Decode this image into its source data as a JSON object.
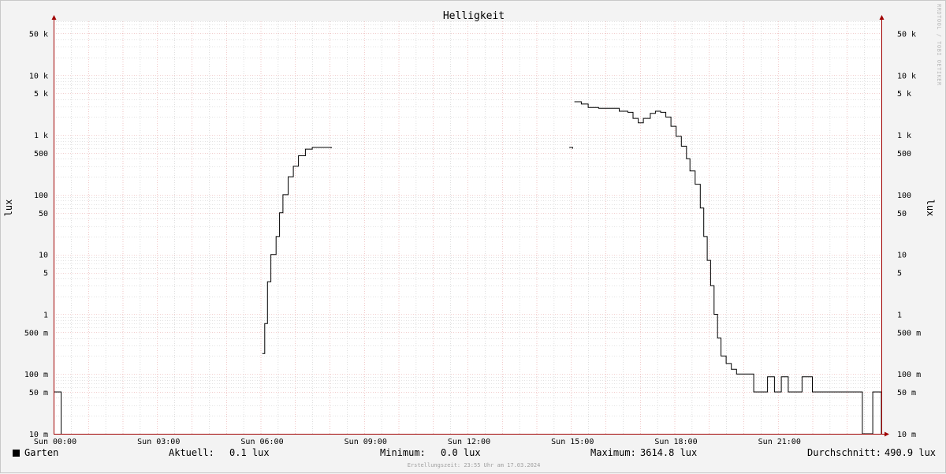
{
  "watermark": "RRDTOOL / TOBI OETIKER",
  "legend": {
    "series_name": "Garten",
    "current_label": "Aktuell:",
    "current_value": "0.1 lux",
    "min_label": "Minimum:",
    "min_value": "0.0 lux",
    "max_label": "Maximum:",
    "max_value": "3614.8 lux",
    "avg_label": "Durchschnitt:",
    "avg_value": "490.9 lux"
  },
  "footer_note": "Erstellungszeit: 23:55 Uhr am 17.03.2024",
  "colors": {
    "line": "#000000",
    "major_grid": "#e6a0a0",
    "minor_grid": "#c8c8c8",
    "plot_bg": "#ffffff",
    "axis": "#a00000"
  },
  "chart_data": {
    "type": "line",
    "title": "Helligkeit",
    "ylabel": "lux",
    "y_scale": "log",
    "ylim": [
      0.01,
      80000
    ],
    "xlim": [
      0,
      24
    ],
    "x_unit": "hours (Sun)",
    "x_ticks": [
      {
        "value": 0,
        "label": "Sun 00:00"
      },
      {
        "value": 3,
        "label": "Sun 03:00"
      },
      {
        "value": 6,
        "label": "Sun 06:00"
      },
      {
        "value": 9,
        "label": "Sun 09:00"
      },
      {
        "value": 12,
        "label": "Sun 12:00"
      },
      {
        "value": 15,
        "label": "Sun 15:00"
      },
      {
        "value": 18,
        "label": "Sun 18:00"
      },
      {
        "value": 21,
        "label": "Sun 21:00"
      }
    ],
    "y_ticks": [
      {
        "value": 0.01,
        "label": "10 m"
      },
      {
        "value": 0.05,
        "label": "50 m"
      },
      {
        "value": 0.1,
        "label": "100 m"
      },
      {
        "value": 0.5,
        "label": "500 m"
      },
      {
        "value": 1,
        "label": "1"
      },
      {
        "value": 5,
        "label": "5"
      },
      {
        "value": 10,
        "label": "10"
      },
      {
        "value": 50,
        "label": "50"
      },
      {
        "value": 100,
        "label": "100"
      },
      {
        "value": 500,
        "label": "500"
      },
      {
        "value": 1000,
        "label": "1 k"
      },
      {
        "value": 5000,
        "label": "5 k"
      },
      {
        "value": 10000,
        "label": "10 k"
      },
      {
        "value": 50000,
        "label": "50 k"
      }
    ],
    "series": [
      {
        "name": "Garten",
        "segments": [
          [
            [
              0.0,
              0.05
            ],
            [
              0.2,
              0.05
            ],
            [
              0.22,
              0.0
            ]
          ],
          [
            [
              6.05,
              0.22
            ],
            [
              6.12,
              0.7
            ],
            [
              6.2,
              3.5
            ],
            [
              6.3,
              10
            ],
            [
              6.45,
              20
            ],
            [
              6.55,
              50
            ],
            [
              6.65,
              100
            ],
            [
              6.8,
              200
            ],
            [
              6.95,
              300
            ],
            [
              7.1,
              450
            ],
            [
              7.3,
              580
            ],
            [
              7.5,
              620
            ],
            [
              7.8,
              620
            ],
            [
              8.05,
              600
            ]
          ],
          [
            [
              14.95,
              620
            ],
            [
              15.05,
              590
            ]
          ],
          [
            [
              15.1,
              3600
            ],
            [
              15.3,
              3300
            ],
            [
              15.5,
              2900
            ],
            [
              15.8,
              2800
            ],
            [
              16.1,
              2800
            ],
            [
              16.4,
              2500
            ],
            [
              16.65,
              2400
            ],
            [
              16.8,
              1900
            ],
            [
              16.95,
              1600
            ],
            [
              17.1,
              1900
            ],
            [
              17.3,
              2300
            ],
            [
              17.45,
              2500
            ],
            [
              17.6,
              2400
            ],
            [
              17.75,
              2000
            ],
            [
              17.9,
              1400
            ],
            [
              18.05,
              950
            ],
            [
              18.2,
              650
            ],
            [
              18.35,
              400
            ],
            [
              18.45,
              250
            ],
            [
              18.6,
              150
            ],
            [
              18.75,
              60
            ],
            [
              18.85,
              20
            ],
            [
              18.95,
              8
            ],
            [
              19.05,
              3
            ],
            [
              19.15,
              1
            ],
            [
              19.25,
              0.4
            ],
            [
              19.35,
              0.2
            ],
            [
              19.5,
              0.15
            ],
            [
              19.65,
              0.12
            ],
            [
              19.8,
              0.1
            ],
            [
              20.1,
              0.1
            ],
            [
              20.3,
              0.05
            ],
            [
              20.5,
              0.05
            ],
            [
              20.7,
              0.09
            ],
            [
              20.9,
              0.05
            ],
            [
              21.1,
              0.09
            ],
            [
              21.3,
              0.05
            ],
            [
              21.5,
              0.05
            ],
            [
              21.7,
              0.09
            ],
            [
              22.0,
              0.05
            ],
            [
              23.4,
              0.05
            ],
            [
              23.45,
              0.0
            ],
            [
              23.7,
              0.0
            ],
            [
              23.75,
              0.05
            ],
            [
              23.95,
              0.05
            ],
            [
              24.0,
              0.0
            ]
          ]
        ]
      }
    ]
  }
}
